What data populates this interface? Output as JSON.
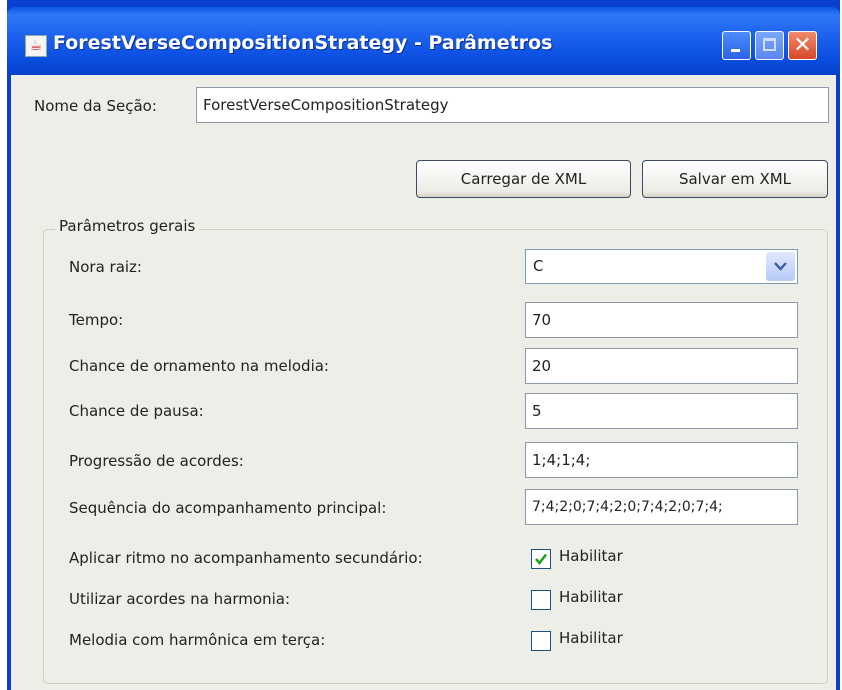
{
  "window": {
    "title": "ForestVerseCompositionStrategy - Parâmetros",
    "title_bar_color": "#0a4fe0",
    "close_button_color": "#d9472a"
  },
  "section": {
    "label": "Nome da Seção:",
    "value": "ForestVerseCompositionStrategy"
  },
  "buttons": {
    "load": "Carregar de XML",
    "save": "Salvar em XML"
  },
  "group": {
    "title": "Parâmetros gerais",
    "root_note": {
      "label": "Nora raiz:",
      "value": "C"
    },
    "tempo": {
      "label": "Tempo:",
      "value": "70"
    },
    "ornament_chance": {
      "label": "Chance de ornamento na melodia:",
      "value": "20"
    },
    "pause_chance": {
      "label": "Chance de pausa:",
      "value": "5"
    },
    "chord_progression": {
      "label": "Progressão de acordes:",
      "value": "1;4;1;4;"
    },
    "main_accompaniment": {
      "label": "Sequência do acompanhamento principal:",
      "value": "7;4;2;0;7;4;2;0;7;4;2;0;7;4;"
    },
    "rhythm_secondary": {
      "label": "Aplicar ritmo no acompanhamento secundário:",
      "checkbox_label": "Habilitar",
      "checked": true
    },
    "chords_harmony": {
      "label": "Utilizar acordes na harmonia:",
      "checkbox_label": "Habilitar",
      "checked": false
    },
    "harmonic_third": {
      "label": "Melodia com harmônica em terça:",
      "checkbox_label": "Habilitar",
      "checked": false
    }
  }
}
